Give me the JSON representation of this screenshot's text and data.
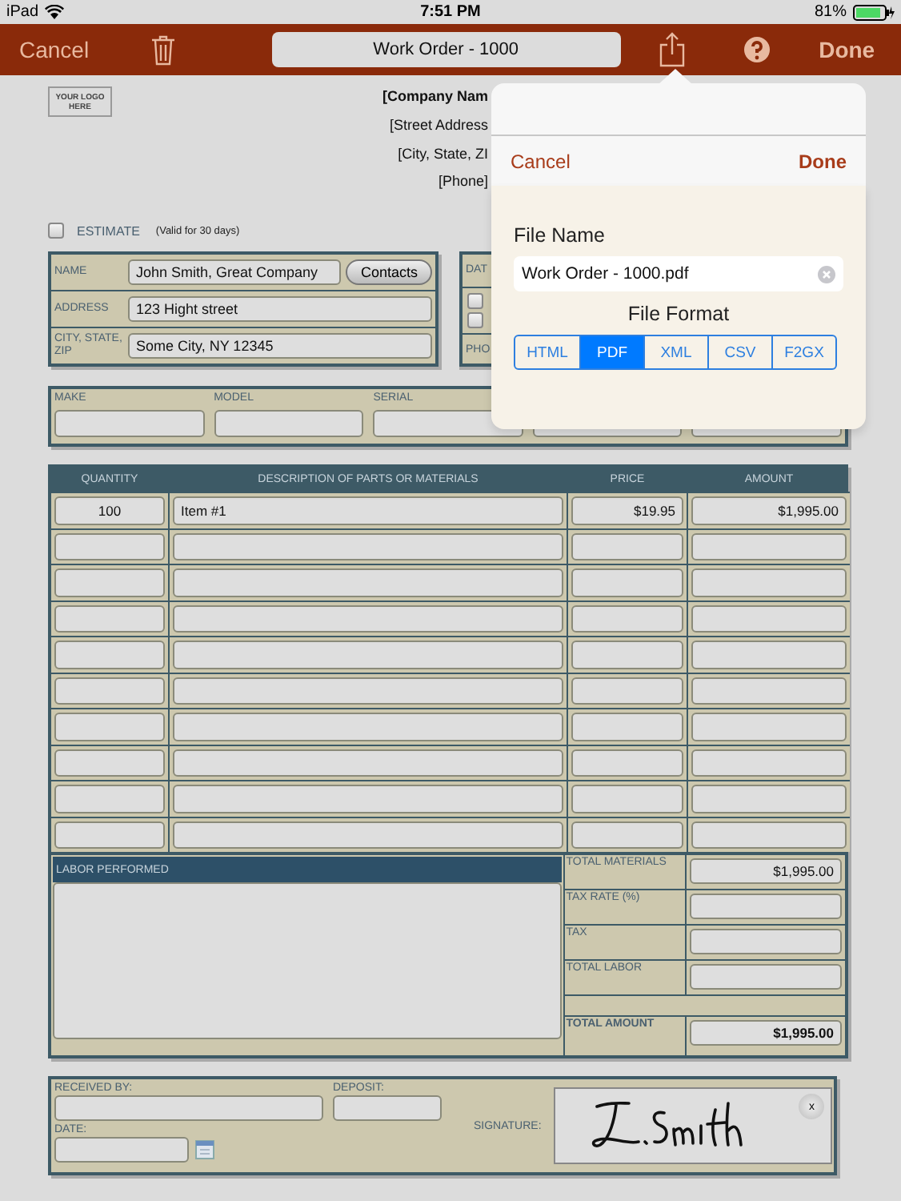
{
  "status_bar": {
    "carrier": "iPad",
    "time": "7:51 PM",
    "battery": "81%"
  },
  "toolbar": {
    "cancel": "Cancel",
    "title": "Work Order - 1000",
    "done": "Done"
  },
  "company": {
    "logo": "YOUR LOGO HERE",
    "lines": [
      {
        "text": "[Company Nam",
        "bold": true
      },
      {
        "text": "[Street Address",
        "bold": false
      },
      {
        "text": "[City, State, ZI",
        "bold": false
      },
      {
        "text": "[Phone]",
        "bold": false
      }
    ]
  },
  "estimate": {
    "label": "ESTIMATE",
    "note": "(Valid for 30 days)",
    "checked": false
  },
  "customer": [
    {
      "label": "NAME",
      "value": "John Smith, Great Company",
      "button": "Contacts"
    },
    {
      "label": "ADDRESS",
      "value": "123 Hight street"
    },
    {
      "label": "CITY, STATE, ZIP",
      "value": "Some City, NY 12345"
    }
  ],
  "side_box": {
    "labels": [
      "DAT",
      "PHO"
    ],
    "options": [
      {
        "checked": false
      },
      {
        "checked": false
      }
    ]
  },
  "equipment": {
    "labels": [
      "MAKE",
      "MODEL",
      "SERIAL"
    ]
  },
  "items": {
    "columns": [
      "QUANTITY",
      "DESCRIPTION OF PARTS OR MATERIALS",
      "PRICE",
      "AMOUNT"
    ],
    "rows": [
      {
        "quantity": "100",
        "description": "Item #1",
        "price": "$19.95",
        "amount": "$1,995.00"
      }
    ]
  },
  "labor": {
    "title": "LABOR PERFORMED"
  },
  "totals": [
    {
      "kind": "line",
      "label": "TOTAL MATERIALS",
      "value": "$1,995.00"
    },
    {
      "kind": "line",
      "label": "TAX RATE (%)"
    },
    {
      "kind": "line",
      "label": "TAX"
    },
    {
      "kind": "line",
      "label": "TOTAL LABOR"
    },
    {
      "kind": "spacer"
    },
    {
      "kind": "grand",
      "label": "TOTAL AMOUNT",
      "value": "$1,995.00"
    }
  ],
  "footer": {
    "received_by": "RECEIVED BY:",
    "deposit": "DEPOSIT:",
    "date": "DATE:",
    "signature": "SIGNATURE:",
    "clear": "x"
  },
  "export_popover": {
    "cancel": "Cancel",
    "done": "Done",
    "file_name_label": "File Name",
    "file_name": "Work Order - 1000.pdf",
    "format_label": "File Format",
    "formats": [
      {
        "label": "HTML",
        "selected": false
      },
      {
        "label": "PDF",
        "selected": true
      },
      {
        "label": "XML",
        "selected": false
      },
      {
        "label": "CSV",
        "selected": false
      },
      {
        "label": "F2GX",
        "selected": false
      }
    ]
  }
}
